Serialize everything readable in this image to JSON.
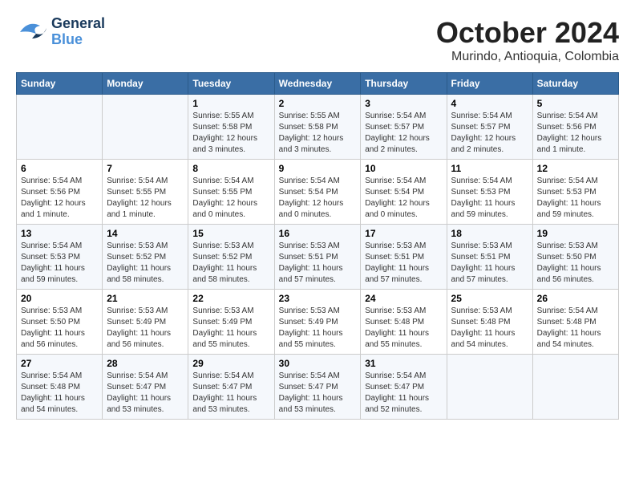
{
  "header": {
    "logo_general": "General",
    "logo_blue": "Blue",
    "month_title": "October 2024",
    "subtitle": "Murindo, Antioquia, Colombia"
  },
  "columns": [
    "Sunday",
    "Monday",
    "Tuesday",
    "Wednesday",
    "Thursday",
    "Friday",
    "Saturday"
  ],
  "weeks": [
    [
      {
        "day": "",
        "info": ""
      },
      {
        "day": "",
        "info": ""
      },
      {
        "day": "1",
        "info": "Sunrise: 5:55 AM\nSunset: 5:58 PM\nDaylight: 12 hours and 3 minutes."
      },
      {
        "day": "2",
        "info": "Sunrise: 5:55 AM\nSunset: 5:58 PM\nDaylight: 12 hours and 3 minutes."
      },
      {
        "day": "3",
        "info": "Sunrise: 5:54 AM\nSunset: 5:57 PM\nDaylight: 12 hours and 2 minutes."
      },
      {
        "day": "4",
        "info": "Sunrise: 5:54 AM\nSunset: 5:57 PM\nDaylight: 12 hours and 2 minutes."
      },
      {
        "day": "5",
        "info": "Sunrise: 5:54 AM\nSunset: 5:56 PM\nDaylight: 12 hours and 1 minute."
      }
    ],
    [
      {
        "day": "6",
        "info": "Sunrise: 5:54 AM\nSunset: 5:56 PM\nDaylight: 12 hours and 1 minute."
      },
      {
        "day": "7",
        "info": "Sunrise: 5:54 AM\nSunset: 5:55 PM\nDaylight: 12 hours and 1 minute."
      },
      {
        "day": "8",
        "info": "Sunrise: 5:54 AM\nSunset: 5:55 PM\nDaylight: 12 hours and 0 minutes."
      },
      {
        "day": "9",
        "info": "Sunrise: 5:54 AM\nSunset: 5:54 PM\nDaylight: 12 hours and 0 minutes."
      },
      {
        "day": "10",
        "info": "Sunrise: 5:54 AM\nSunset: 5:54 PM\nDaylight: 12 hours and 0 minutes."
      },
      {
        "day": "11",
        "info": "Sunrise: 5:54 AM\nSunset: 5:53 PM\nDaylight: 11 hours and 59 minutes."
      },
      {
        "day": "12",
        "info": "Sunrise: 5:54 AM\nSunset: 5:53 PM\nDaylight: 11 hours and 59 minutes."
      }
    ],
    [
      {
        "day": "13",
        "info": "Sunrise: 5:54 AM\nSunset: 5:53 PM\nDaylight: 11 hours and 59 minutes."
      },
      {
        "day": "14",
        "info": "Sunrise: 5:53 AM\nSunset: 5:52 PM\nDaylight: 11 hours and 58 minutes."
      },
      {
        "day": "15",
        "info": "Sunrise: 5:53 AM\nSunset: 5:52 PM\nDaylight: 11 hours and 58 minutes."
      },
      {
        "day": "16",
        "info": "Sunrise: 5:53 AM\nSunset: 5:51 PM\nDaylight: 11 hours and 57 minutes."
      },
      {
        "day": "17",
        "info": "Sunrise: 5:53 AM\nSunset: 5:51 PM\nDaylight: 11 hours and 57 minutes."
      },
      {
        "day": "18",
        "info": "Sunrise: 5:53 AM\nSunset: 5:51 PM\nDaylight: 11 hours and 57 minutes."
      },
      {
        "day": "19",
        "info": "Sunrise: 5:53 AM\nSunset: 5:50 PM\nDaylight: 11 hours and 56 minutes."
      }
    ],
    [
      {
        "day": "20",
        "info": "Sunrise: 5:53 AM\nSunset: 5:50 PM\nDaylight: 11 hours and 56 minutes."
      },
      {
        "day": "21",
        "info": "Sunrise: 5:53 AM\nSunset: 5:49 PM\nDaylight: 11 hours and 56 minutes."
      },
      {
        "day": "22",
        "info": "Sunrise: 5:53 AM\nSunset: 5:49 PM\nDaylight: 11 hours and 55 minutes."
      },
      {
        "day": "23",
        "info": "Sunrise: 5:53 AM\nSunset: 5:49 PM\nDaylight: 11 hours and 55 minutes."
      },
      {
        "day": "24",
        "info": "Sunrise: 5:53 AM\nSunset: 5:48 PM\nDaylight: 11 hours and 55 minutes."
      },
      {
        "day": "25",
        "info": "Sunrise: 5:53 AM\nSunset: 5:48 PM\nDaylight: 11 hours and 54 minutes."
      },
      {
        "day": "26",
        "info": "Sunrise: 5:54 AM\nSunset: 5:48 PM\nDaylight: 11 hours and 54 minutes."
      }
    ],
    [
      {
        "day": "27",
        "info": "Sunrise: 5:54 AM\nSunset: 5:48 PM\nDaylight: 11 hours and 54 minutes."
      },
      {
        "day": "28",
        "info": "Sunrise: 5:54 AM\nSunset: 5:47 PM\nDaylight: 11 hours and 53 minutes."
      },
      {
        "day": "29",
        "info": "Sunrise: 5:54 AM\nSunset: 5:47 PM\nDaylight: 11 hours and 53 minutes."
      },
      {
        "day": "30",
        "info": "Sunrise: 5:54 AM\nSunset: 5:47 PM\nDaylight: 11 hours and 53 minutes."
      },
      {
        "day": "31",
        "info": "Sunrise: 5:54 AM\nSunset: 5:47 PM\nDaylight: 11 hours and 52 minutes."
      },
      {
        "day": "",
        "info": ""
      },
      {
        "day": "",
        "info": ""
      }
    ]
  ]
}
